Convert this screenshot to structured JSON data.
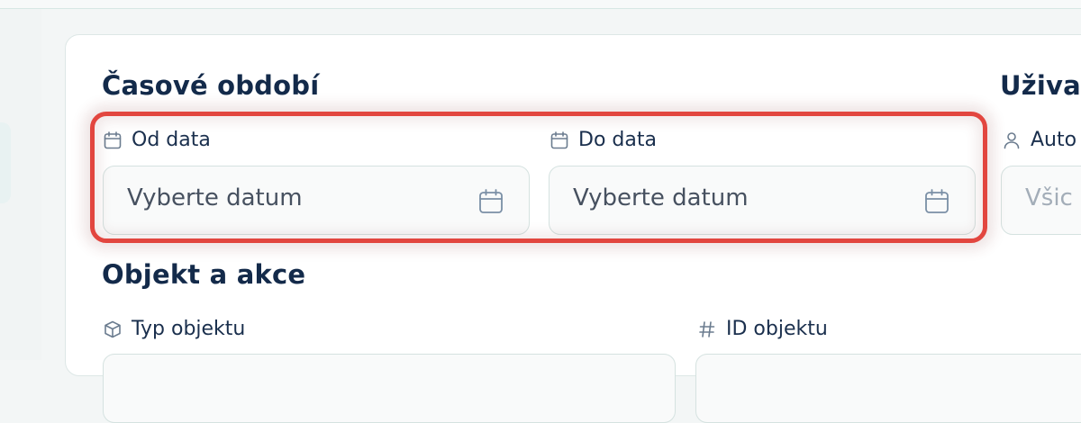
{
  "filters": {
    "time_period": {
      "title": "Časové období",
      "from": {
        "label": "Od data",
        "placeholder": "Vyberte datum"
      },
      "to": {
        "label": "Do data",
        "placeholder": "Vyberte datum"
      }
    },
    "user": {
      "title": "Uživat",
      "author": {
        "label": "Auto",
        "placeholder": "Všic"
      }
    },
    "object_action": {
      "title": "Objekt a akce",
      "object_type": {
        "label": "Typ objektu"
      },
      "object_id": {
        "label": "ID objektu"
      }
    }
  },
  "icons": {
    "calendar": "calendar-icon",
    "user": "user-icon",
    "cube": "cube-icon",
    "hash": "hash-icon"
  },
  "colors": {
    "highlight": "#e2463f",
    "title": "#132a4a",
    "placeholder": "#475160",
    "icon": "#6b7c8f"
  }
}
